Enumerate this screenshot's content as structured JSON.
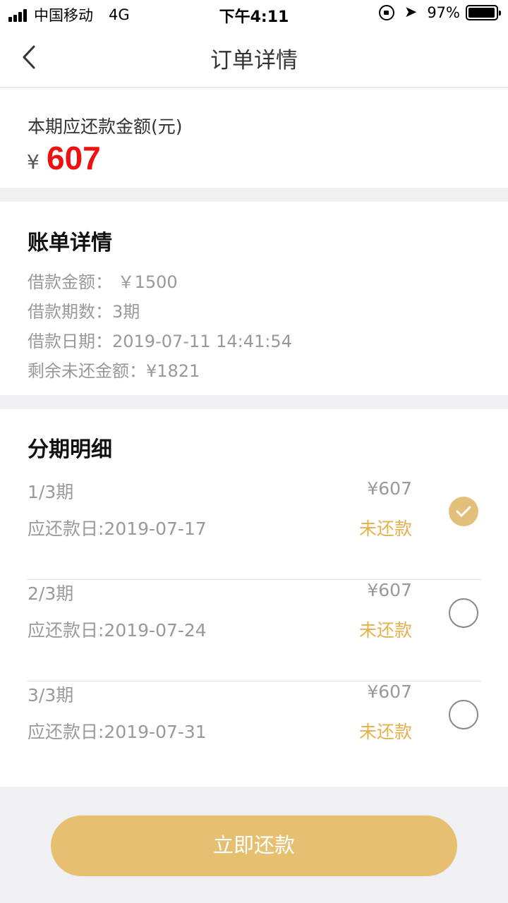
{
  "status_bar": {
    "carrier": "中国移动",
    "network": "4G",
    "time": "下午4:11",
    "battery": "97%"
  },
  "nav": {
    "title": "订单详情"
  },
  "due": {
    "label": "本期应还款金额(元)",
    "currency": "¥",
    "amount": "607"
  },
  "bill": {
    "title": "账单详情",
    "lines": [
      "借款金额： ￥1500",
      "借款期数：3期",
      "借款日期：2019-07-11 14:41:54",
      "剩余未还金额：¥1821"
    ]
  },
  "installments": {
    "title": "分期明细",
    "rows": [
      {
        "period": "1/3期",
        "amount": "¥607",
        "date": "应还款日:2019-07-17",
        "status": "未还款",
        "selected": true
      },
      {
        "period": "2/3期",
        "amount": "¥607",
        "date": "应还款日:2019-07-24",
        "status": "未还款",
        "selected": false
      },
      {
        "period": "3/3期",
        "amount": "¥607",
        "date": "应还款日:2019-07-31",
        "status": "未还款",
        "selected": false
      }
    ]
  },
  "pay_button": {
    "label": "立即还款"
  },
  "colors": {
    "accent": "#e6c070",
    "amount_red": "#ee1111",
    "status_orange": "#e6b14a"
  }
}
